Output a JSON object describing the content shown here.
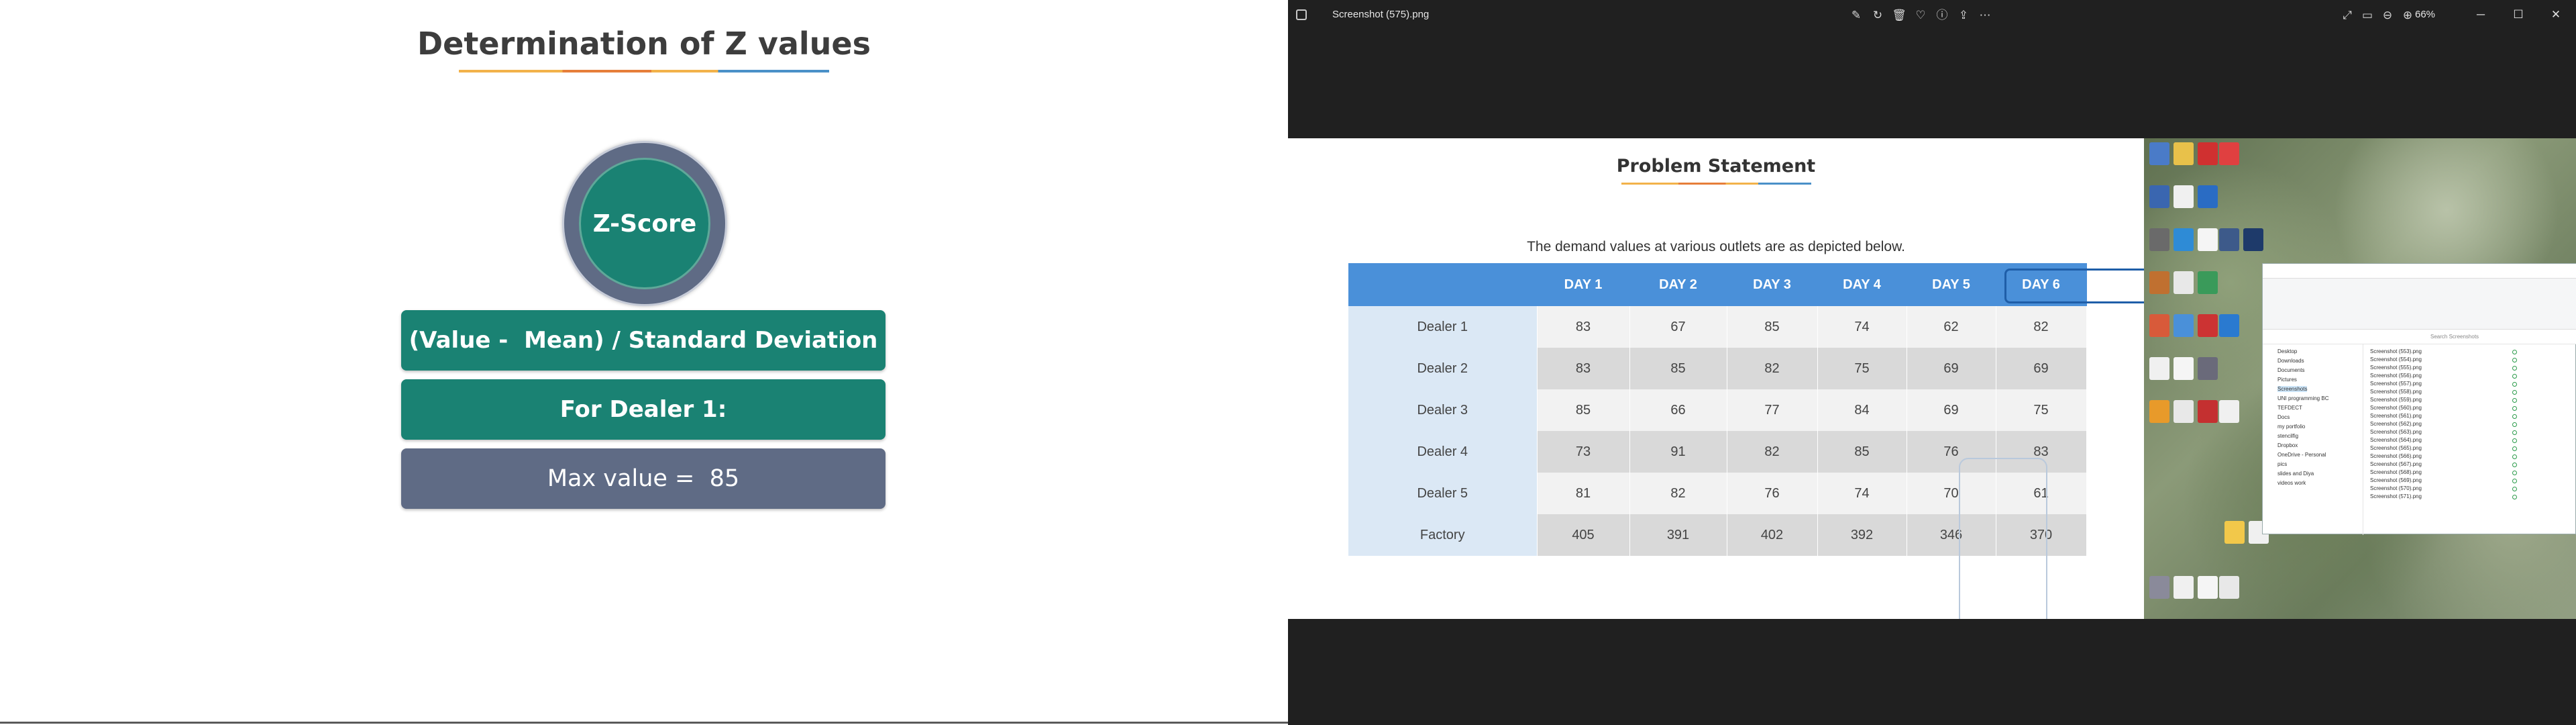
{
  "left_slide": {
    "title": "Determination of Z values",
    "circle_label": "Z-Score",
    "formula": "(Value -  Mean) / Standard Deviation",
    "dealer_label": "For Dealer 1:",
    "max_value": "Max value =  85"
  },
  "viewer": {
    "file_title": "Screenshot (575).png",
    "zoom": "66%",
    "toolbar_icons": [
      "edit-icon",
      "rotate-icon",
      "delete-icon",
      "favorite-icon",
      "info-icon",
      "share-icon",
      "more-icon"
    ],
    "right_icons": [
      "expand-icon",
      "fit-icon",
      "zoom-out-icon",
      "zoom-in-icon"
    ],
    "window_controls": [
      "minimize-icon",
      "maximize-icon",
      "close-icon"
    ],
    "colors": {
      "background": "#202020",
      "accent": "#4a90d9"
    }
  },
  "problem_slide": {
    "title": "Problem Statement",
    "subtitle": "The demand values at various outlets are as depicted below.",
    "table": {
      "columns": [
        "DAY 1",
        "DAY 2",
        "DAY 3",
        "DAY 4",
        "DAY 5",
        "DAY 6"
      ],
      "rows": [
        {
          "label": "Dealer 1",
          "values": [
            "83",
            "67",
            "85",
            "74",
            "62",
            "82"
          ]
        },
        {
          "label": "Dealer 2",
          "values": [
            "83",
            "85",
            "82",
            "75",
            "69",
            "69"
          ]
        },
        {
          "label": "Dealer 3",
          "values": [
            "85",
            "66",
            "77",
            "84",
            "69",
            "75"
          ]
        },
        {
          "label": "Dealer 4",
          "values": [
            "73",
            "91",
            "82",
            "85",
            "76",
            "83"
          ]
        },
        {
          "label": "Dealer 5",
          "values": [
            "81",
            "82",
            "76",
            "74",
            "70",
            "61"
          ]
        }
      ],
      "total": {
        "label": "Factory",
        "values": [
          "405",
          "391",
          "402",
          "392",
          "346",
          "370"
        ]
      }
    }
  },
  "desktop_explorer": {
    "nav_items": [
      "Desktop",
      "Downloads",
      "Documents",
      "Pictures",
      "Screenshots",
      "UNI programming BC",
      "TEFDECT",
      "Docs",
      "my portfolio",
      "stencilfig",
      "Dropbox",
      "OneDrive - Personal",
      "pics",
      "slides and Diya",
      "videos work"
    ],
    "files": [
      "Screenshot (553).png",
      "Screenshot (554).png",
      "Screenshot (555).png",
      "Screenshot (556).png",
      "Screenshot (557).png",
      "Screenshot (558).png",
      "Screenshot (559).png",
      "Screenshot (560).png",
      "Screenshot (561).png",
      "Screenshot (562).png",
      "Screenshot (563).png",
      "Screenshot (564).png",
      "Screenshot (565).png",
      "Screenshot (566).png",
      "Screenshot (567).png",
      "Screenshot (568).png",
      "Screenshot (569).png",
      "Screenshot (570).png",
      "Screenshot (571).png"
    ],
    "search_placeholder": "Search Screenshots"
  }
}
